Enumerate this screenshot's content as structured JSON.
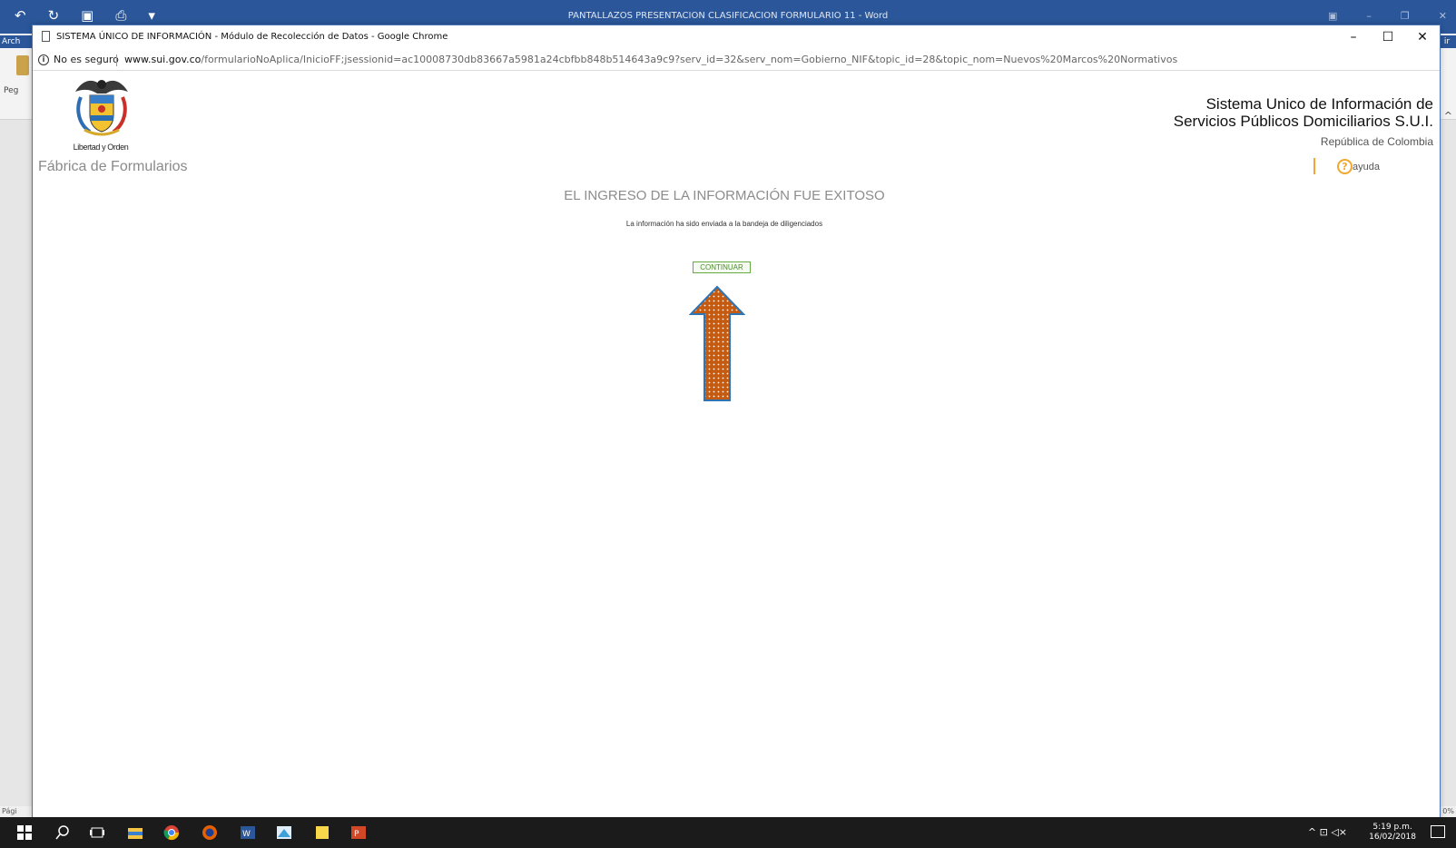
{
  "word": {
    "title": "PANTALLAZOS PRESENTACION CLASIFICACION FORMULARIO 11 - Word",
    "qat_icons": [
      "undo-icon",
      "redo-icon",
      "save-icon",
      "print-preview-icon",
      "customize-icon"
    ],
    "menu_left": "Arch",
    "menu_right": "ir",
    "paste_label": "Peg",
    "status_left": "Pági",
    "status_right": "0%"
  },
  "chrome": {
    "window_title": "SISTEMA ÚNICO DE INFORMACIÓN - Módulo de Recolección de Datos - Google Chrome",
    "not_secure": "No es seguro",
    "url_host": "www.sui.gov.co",
    "url_path": "/formularioNoAplica/InicioFF;jsessionid=ac10008730db83667a5981a24cbfbb848b514643a9c9?serv_id=32&serv_nom=Gobierno_NIF&topic_id=28&topic_nom=Nuevos%20Marcos%20Normativos"
  },
  "page": {
    "motto": "Libertad y Orden",
    "section_title": "Fábrica de Formularios",
    "system_title_line1": "Sistema Unico de Información de",
    "system_title_line2": "Servicios Públicos Domiciliarios S.U.I.",
    "country": "República de Colombia",
    "help_label": "ayuda",
    "success_heading": "EL INGRESO DE LA INFORMACIÓN FUE EXITOSO",
    "success_message": "La información ha sido enviada a la bandeja de diligenciados",
    "continue_label": "CONTINUAR"
  },
  "taskbar": {
    "time": "5:19 p.m.",
    "date": "16/02/2018",
    "apps": [
      "windows-start-icon",
      "search-icon",
      "task-view-icon",
      "file-explorer-icon",
      "chrome-icon",
      "firefox-icon",
      "word-icon",
      "paint-icon",
      "sticky-notes-icon",
      "powerpoint-icon"
    ]
  },
  "colors": {
    "word_blue": "#2b579a",
    "arrow_fill": "#c55a11",
    "arrow_border": "#2e75b6",
    "continue_green": "#66aa44",
    "help_orange": "#f0a830"
  }
}
